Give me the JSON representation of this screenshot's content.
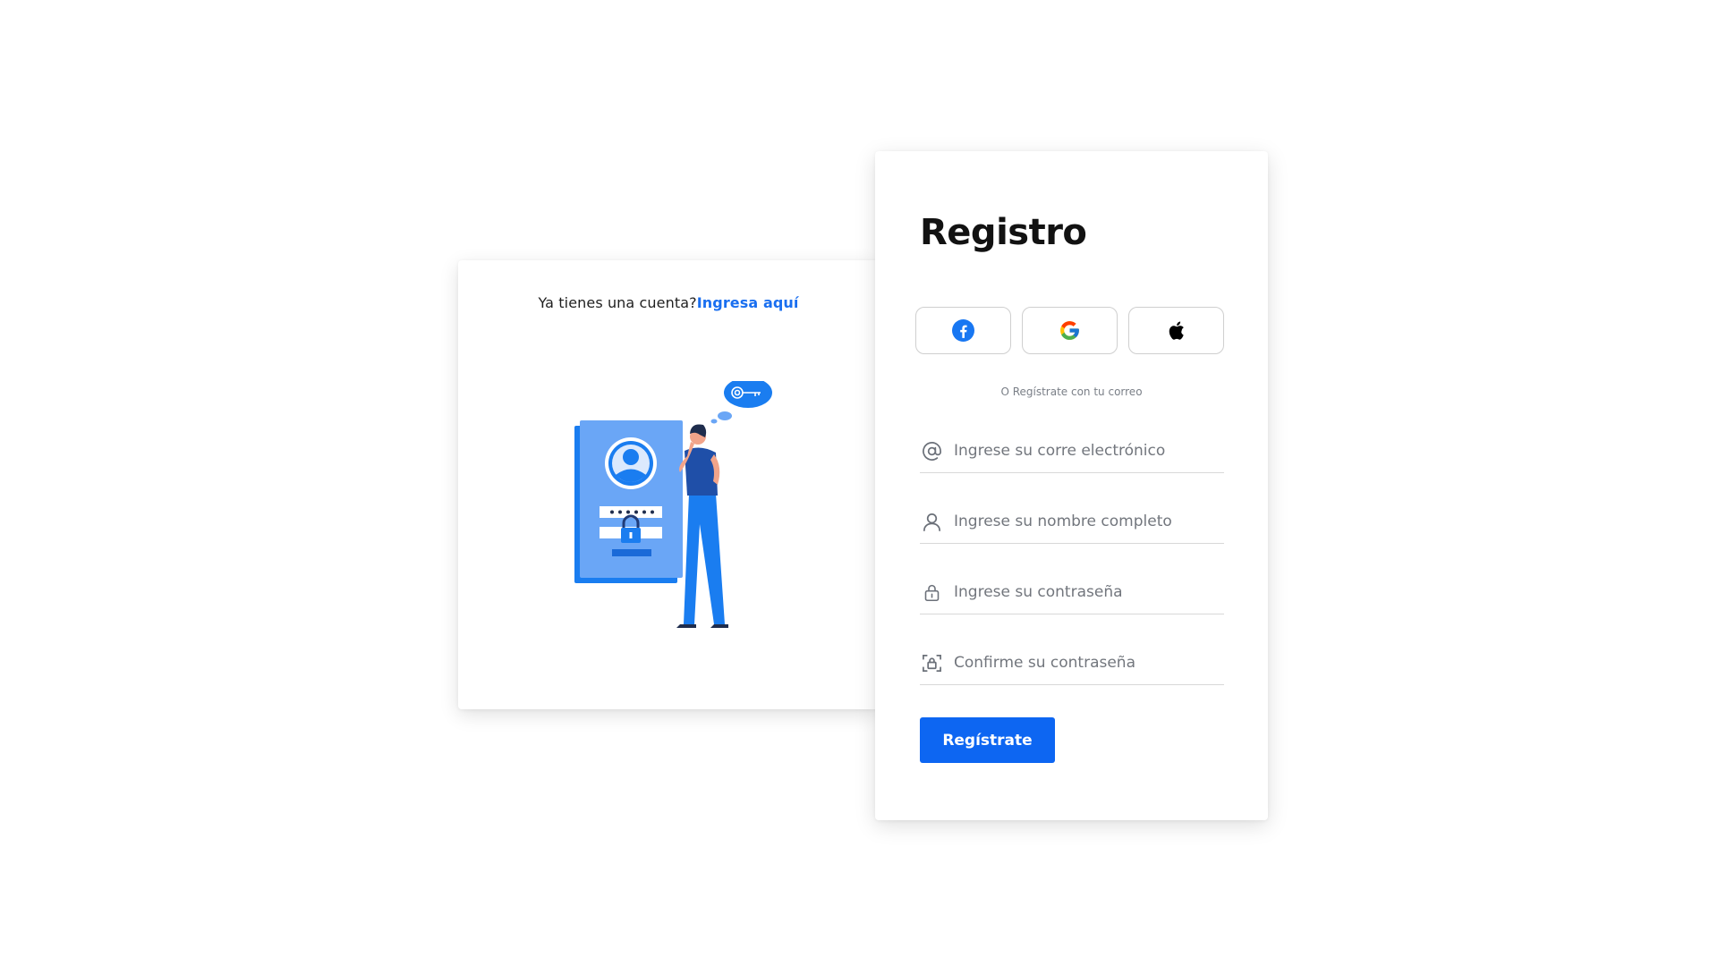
{
  "login_prompt": {
    "text": "Ya tienes una cuenta?",
    "link": "Ingresa aquí"
  },
  "register": {
    "title": "Registro",
    "social": [
      {
        "name": "facebook",
        "icon": "facebook-icon",
        "color": "#1877f2"
      },
      {
        "name": "google",
        "icon": "google-icon"
      },
      {
        "name": "apple",
        "icon": "apple-icon",
        "color": "#000000"
      }
    ],
    "divider_text": "O Regístrate con tu correo",
    "fields": {
      "email": {
        "placeholder": "Ingrese su corre electrónico",
        "icon": "at-icon"
      },
      "name": {
        "placeholder": "Ingrese su nombre completo",
        "icon": "user-icon"
      },
      "password": {
        "placeholder": "Ingrese su contraseña",
        "icon": "lock-icon"
      },
      "confirm": {
        "placeholder": "Confirme su contraseña",
        "icon": "lock-frame-icon"
      }
    },
    "submit_label": "Regístrate"
  },
  "colors": {
    "accent": "#0d66f2",
    "link": "#1a6ff0",
    "illustration_blue": "#1a7df0",
    "illustration_light": "#6aa6f6"
  }
}
